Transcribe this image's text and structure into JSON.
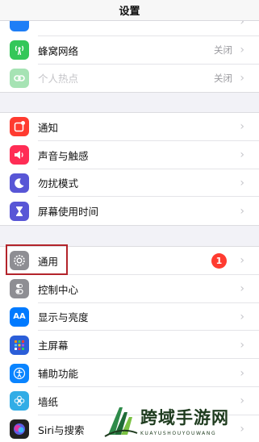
{
  "navbar": {
    "title": "设置"
  },
  "group1": [
    {
      "label": "",
      "value": "",
      "icon": "partial-icon",
      "color": "#1e7ef6"
    },
    {
      "label": "蜂窝网络",
      "value": "关闭",
      "icon": "cellular-antenna-icon",
      "color": "#34c759"
    },
    {
      "label": "个人热点",
      "value": "关闭",
      "icon": "hotspot-link-icon",
      "color": "#a6e3b4"
    }
  ],
  "group2": [
    {
      "label": "通知",
      "icon": "notification-icon",
      "color": "#ff3b30"
    },
    {
      "label": "声音与触感",
      "icon": "speaker-icon",
      "color": "#ff2d55"
    },
    {
      "label": "勿扰模式",
      "icon": "moon-icon",
      "color": "#5856d6"
    },
    {
      "label": "屏幕使用时间",
      "icon": "hourglass-icon",
      "color": "#5856d6"
    }
  ],
  "group3": [
    {
      "label": "通用",
      "badge": "1",
      "icon": "gear-icon",
      "color": "#8e8e93"
    },
    {
      "label": "控制中心",
      "icon": "toggles-icon",
      "color": "#8e8e93"
    },
    {
      "label": "显示与亮度",
      "icon": "text-size-icon",
      "color": "#007aff"
    },
    {
      "label": "主屏幕",
      "icon": "app-grid-icon",
      "color": "#2b5ed8"
    },
    {
      "label": "辅助功能",
      "icon": "accessibility-icon",
      "color": "#0a84ff"
    },
    {
      "label": "墙纸",
      "icon": "flower-icon",
      "color": "#32ade6"
    },
    {
      "label": "Siri与搜索",
      "icon": "siri-icon",
      "color": "#222"
    }
  ],
  "text_icons": {
    "display": "AA"
  },
  "watermark": {
    "main": "跨域手游网",
    "sub": "KUAYUSHOUYOUWANG"
  }
}
